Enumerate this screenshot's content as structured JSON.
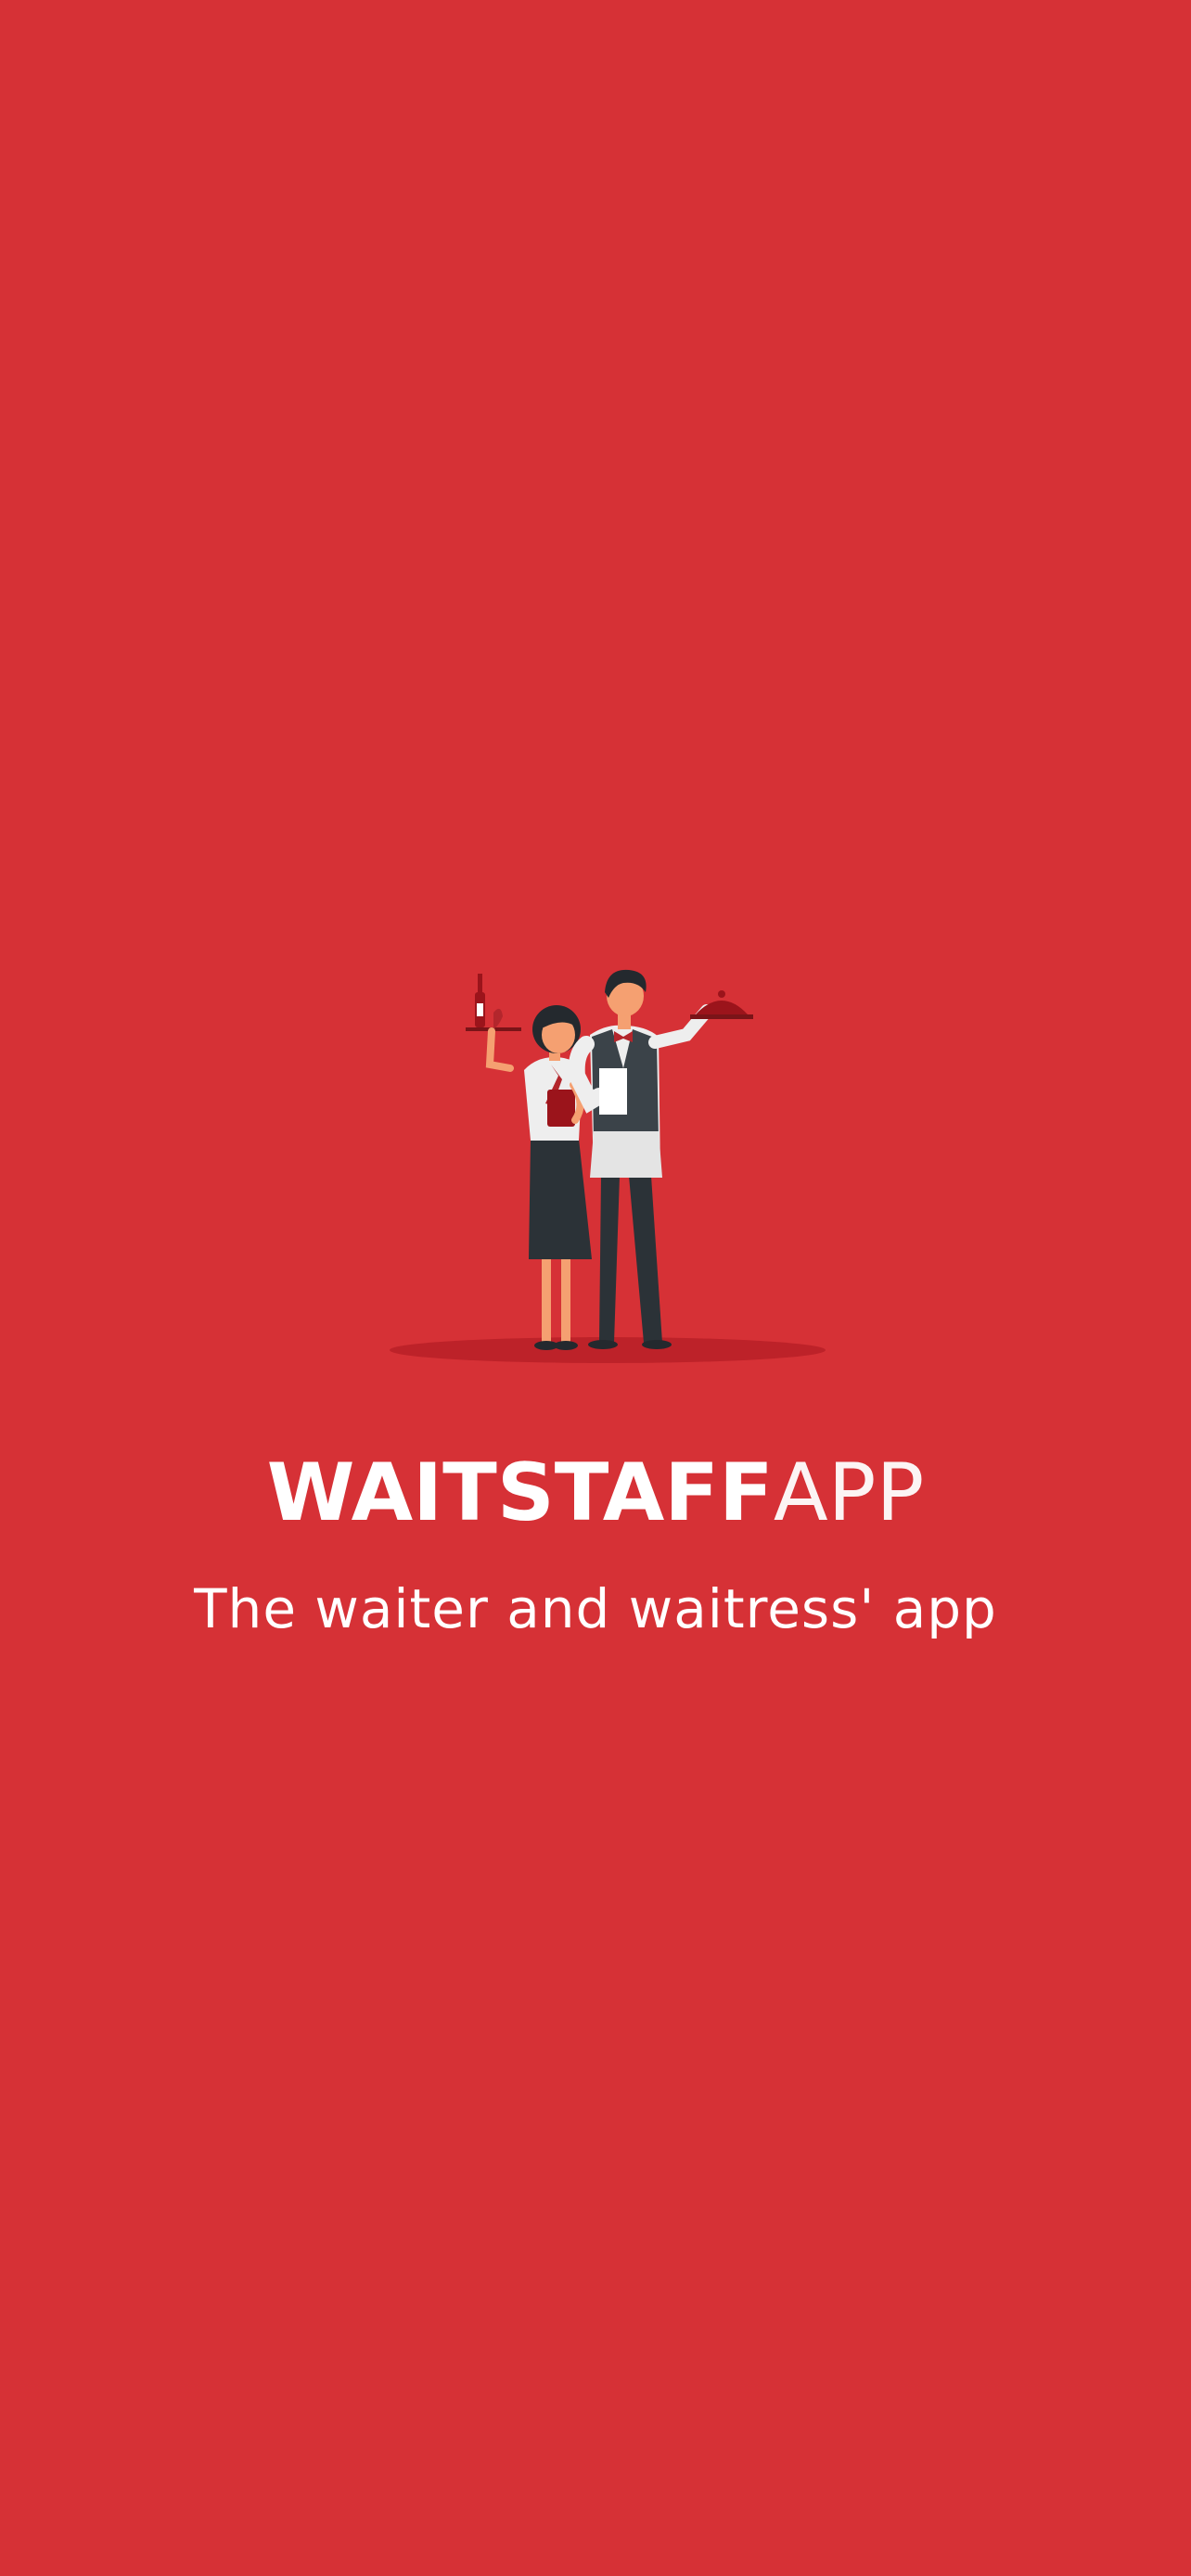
{
  "colors": {
    "background": "#d63136",
    "text": "#ffffff",
    "shadow": "#c1252b"
  },
  "splash": {
    "illustration_icon": "waiter-and-waitress-illustration",
    "brand_bold": "WAITSTAFF",
    "brand_light": "APP",
    "tagline": "The waiter and waitress' app"
  }
}
